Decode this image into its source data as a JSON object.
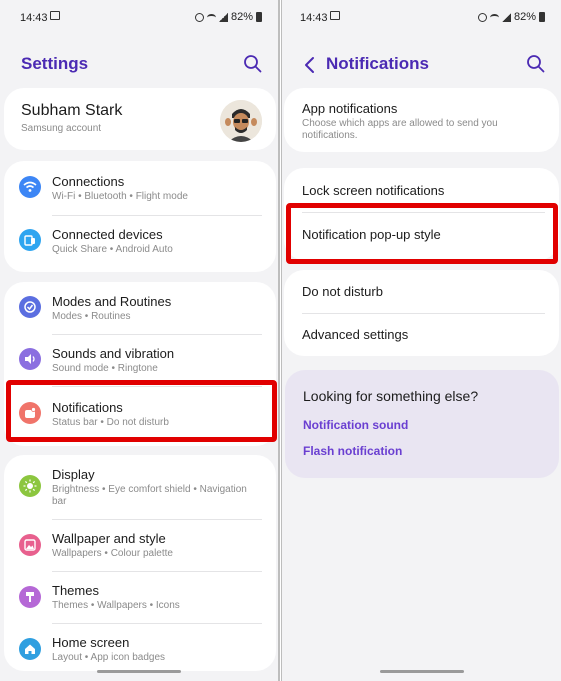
{
  "status_bar": {
    "time": "14:43",
    "battery": "82%",
    "icons": [
      "alarm-icon",
      "wifi-icon",
      "signal-icon",
      "battery-icon"
    ]
  },
  "left": {
    "title": "Settings",
    "account": {
      "name": "Subham Stark",
      "subtitle": "Samsung account"
    },
    "groups": [
      [
        {
          "title": "Connections",
          "subtitle": "Wi-Fi  •  Bluetooth  •  Flight mode",
          "icon": "wifi-icon",
          "color": "#3d86f5"
        },
        {
          "title": "Connected devices",
          "subtitle": "Quick Share  •  Android Auto",
          "icon": "devices-icon",
          "color": "#2fa5f0"
        }
      ],
      [
        {
          "title": "Modes and Routines",
          "subtitle": "Modes  •  Routines",
          "icon": "routines-icon",
          "color": "#5b6ee0"
        },
        {
          "title": "Sounds and vibration",
          "subtitle": "Sound mode  •  Ringtone",
          "icon": "sound-icon",
          "color": "#8b6fe0"
        },
        {
          "title": "Notifications",
          "subtitle": "Status bar  •  Do not disturb",
          "icon": "notifications-icon",
          "color": "#f0746a"
        }
      ],
      [
        {
          "title": "Display",
          "subtitle": "Brightness  •  Eye comfort shield  •  Navigation bar",
          "icon": "display-icon",
          "color": "#8cc63f"
        },
        {
          "title": "Wallpaper and style",
          "subtitle": "Wallpapers  •  Colour palette",
          "icon": "wallpaper-icon",
          "color": "#e8608e"
        },
        {
          "title": "Themes",
          "subtitle": "Themes  •  Wallpapers  •  Icons",
          "icon": "themes-icon",
          "color": "#b568d6"
        },
        {
          "title": "Home screen",
          "subtitle": "Layout  •  App icon badges",
          "icon": "home-icon",
          "color": "#2f9fe0"
        }
      ]
    ]
  },
  "right": {
    "title": "Notifications",
    "app_notifications": {
      "title": "App notifications",
      "subtitle": "Choose which apps are allowed to send you notifications."
    },
    "items": [
      "Lock screen notifications",
      "Notification pop-up style",
      "Do not disturb",
      "Advanced settings"
    ],
    "suggestions": {
      "title": "Looking for something else?",
      "links": [
        "Notification sound",
        "Flash notification"
      ]
    }
  },
  "colors": {
    "accent": "#4b2ab3",
    "link": "#6a3fd1",
    "highlight": "#e10000"
  }
}
